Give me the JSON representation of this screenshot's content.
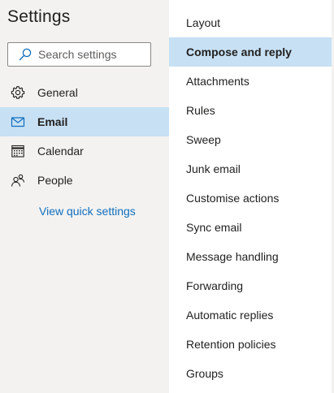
{
  "settings": {
    "title": "Settings",
    "search": {
      "placeholder": "Search settings",
      "value": ""
    },
    "nav": [
      {
        "label": "General",
        "icon": "gear-icon",
        "active": false
      },
      {
        "label": "Email",
        "icon": "mail-icon",
        "active": true
      },
      {
        "label": "Calendar",
        "icon": "calendar-icon",
        "active": false
      },
      {
        "label": "People",
        "icon": "people-icon",
        "active": false
      }
    ],
    "quick_settings_link": "View quick settings"
  },
  "email_settings": {
    "items": [
      {
        "label": "Layout",
        "active": false
      },
      {
        "label": "Compose and reply",
        "active": true
      },
      {
        "label": "Attachments",
        "active": false
      },
      {
        "label": "Rules",
        "active": false
      },
      {
        "label": "Sweep",
        "active": false
      },
      {
        "label": "Junk email",
        "active": false
      },
      {
        "label": "Customise actions",
        "active": false
      },
      {
        "label": "Sync email",
        "active": false
      },
      {
        "label": "Message handling",
        "active": false
      },
      {
        "label": "Forwarding",
        "active": false
      },
      {
        "label": "Automatic replies",
        "active": false
      },
      {
        "label": "Retention policies",
        "active": false
      },
      {
        "label": "Groups",
        "active": false
      }
    ]
  },
  "colors": {
    "background": "#f3f2f1",
    "panel": "#ffffff",
    "selected": "#c7e0f4",
    "link": "#106ebe",
    "text": "#201f1e"
  }
}
